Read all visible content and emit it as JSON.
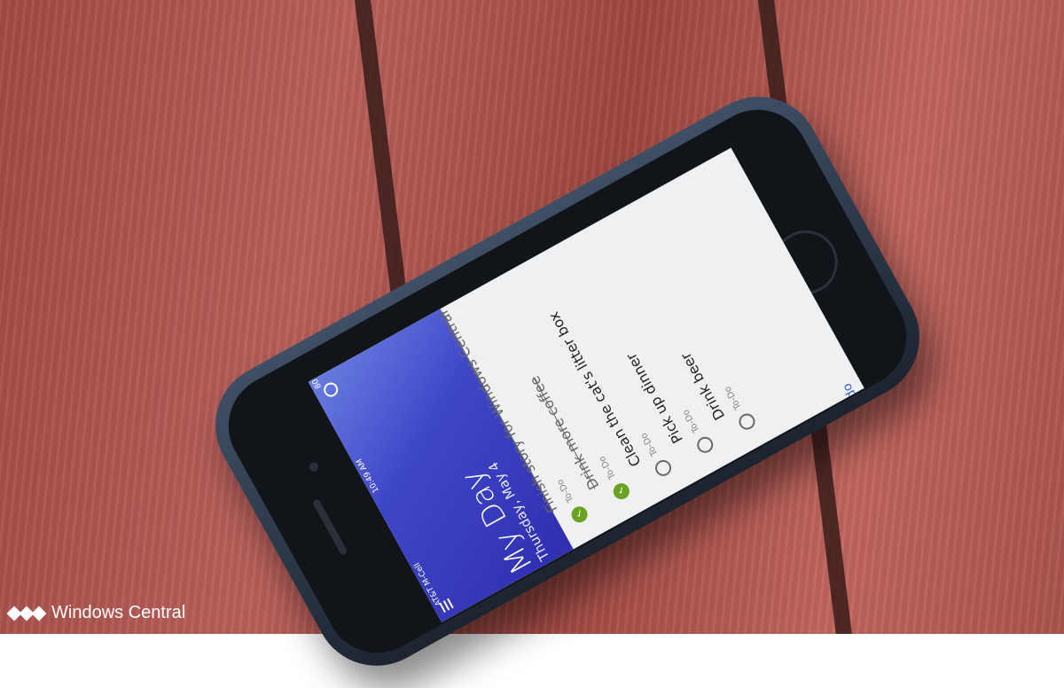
{
  "status_bar": {
    "carrier": "AT&T M-Cell",
    "time": "10:49 AM",
    "battery": "80%"
  },
  "header": {
    "title": "My Day",
    "date": "Thursday, May 4"
  },
  "tasks": [
    {
      "name": "Finish story for Windows Central",
      "list": "To-Do",
      "completed": true
    },
    {
      "name": "Drink more coffee",
      "list": "To-Do",
      "completed": true
    },
    {
      "name": "Clean the cat's litter box",
      "list": "To-Do",
      "completed": false
    },
    {
      "name": "Pick up dinner",
      "list": "To-Do",
      "completed": false
    },
    {
      "name": "Drink beer",
      "list": "To-Do",
      "completed": false
    }
  ],
  "add_todo_label": "Add a to-do",
  "watermark": "Windows Central",
  "colors": {
    "header_gradient": "#4a55d6",
    "check": "#6aa321",
    "accent": "#3b5bd8",
    "deck": "#a34a45"
  }
}
